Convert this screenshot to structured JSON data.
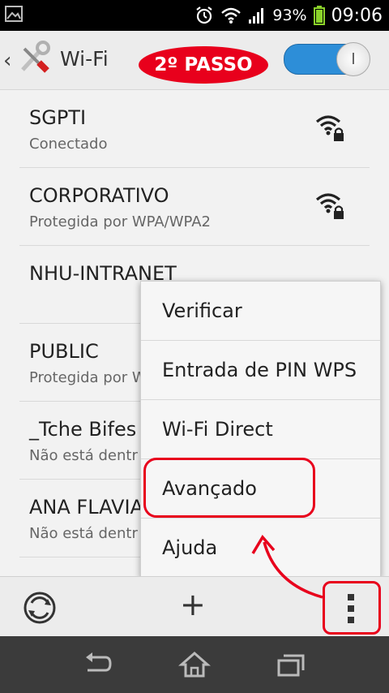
{
  "status_bar": {
    "battery_percent": "93%",
    "time": "09:06"
  },
  "action_bar": {
    "title": "Wi-Fi",
    "toggle_on": true
  },
  "annotation": {
    "step_label": "2º PASSO",
    "color": "#e8001c"
  },
  "networks": [
    {
      "ssid": "SGPTI",
      "status": "Conectado",
      "locked": true
    },
    {
      "ssid": "CORPORATIVO",
      "status": "Protegida por WPA/WPA2",
      "locked": true
    },
    {
      "ssid": "NHU-INTRANET",
      "status": "",
      "locked": true
    },
    {
      "ssid": "PUBLIC",
      "status": "Protegida por W",
      "locked": true
    },
    {
      "ssid": "_Tche Bifes",
      "status": "Não está dentr",
      "locked": false
    },
    {
      "ssid": "ANA FLAVIA",
      "status": "Não está dentr",
      "locked": false
    }
  ],
  "menu": {
    "items": [
      {
        "label": "Verificar"
      },
      {
        "label": "Entrada de PIN WPS"
      },
      {
        "label": "Wi-Fi Direct"
      },
      {
        "label": "Avançado"
      },
      {
        "label": "Ajuda"
      }
    ]
  },
  "toolbar": {
    "add_label": "+"
  },
  "icons": {
    "wifi": "wifi-lock-icon",
    "wps": "wps-icon",
    "more": "overflow-menu-icon",
    "back": "back-icon",
    "home": "home-icon",
    "recents": "recents-icon"
  },
  "colors": {
    "accent": "#2d8ed8",
    "annotation_red": "#e8001c"
  }
}
